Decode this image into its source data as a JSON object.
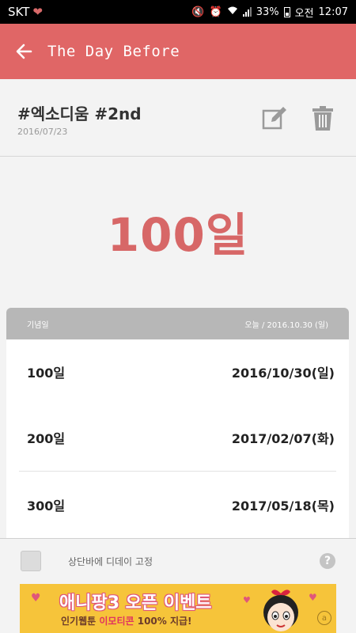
{
  "status_bar": {
    "carrier": "SKT",
    "battery": "33%",
    "ampm": "오전",
    "time": "12:07"
  },
  "app_bar": {
    "title": "The Day Before",
    "color": "#e06666"
  },
  "event": {
    "name": "#엑소디움 #2nd",
    "date": "2016/07/23"
  },
  "count": {
    "display": "100일",
    "color": "#d76767"
  },
  "milestones": {
    "header_left": "기념일",
    "header_right": "오늘 / 2016.10.30 (일)",
    "rows": [
      {
        "day": "100일",
        "date": "2016/10/30(일)"
      },
      {
        "day": "200일",
        "date": "2017/02/07(화)"
      },
      {
        "day": "300일",
        "date": "2017/05/18(목)"
      }
    ]
  },
  "pin_option": {
    "label": "상단바에 디데이 고정",
    "checked": false,
    "help": "?"
  },
  "ad": {
    "headline": "애니팡3 오픈 이벤트",
    "sub_prefix": "인기웹툰",
    "sub_highlight": "이모티콘",
    "sub_suffix": "100% 지급!",
    "badge": "a"
  }
}
